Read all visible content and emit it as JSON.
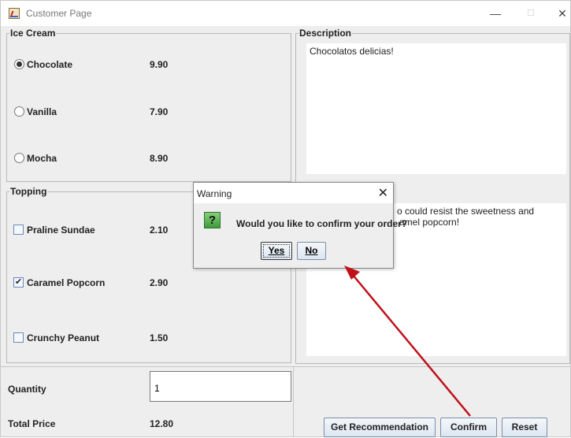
{
  "window": {
    "title": "Customer Page",
    "minimize_glyph": "—",
    "maximize_glyph": "☐",
    "close_glyph": "✕"
  },
  "ice_cream": {
    "title": "Ice Cream",
    "items": [
      {
        "label": "Chocolate",
        "price": "9.90",
        "selected": true
      },
      {
        "label": "Vanilla",
        "price": "7.90",
        "selected": false
      },
      {
        "label": "Mocha",
        "price": "8.90",
        "selected": false
      }
    ]
  },
  "topping": {
    "title": "Topping",
    "items": [
      {
        "label": "Praline Sundae",
        "price": "2.10",
        "checked": false
      },
      {
        "label": "Caramel Popcorn",
        "price": "2.90",
        "checked": true
      },
      {
        "label": "Crunchy Peanut",
        "price": "1.50",
        "checked": false
      }
    ]
  },
  "description": {
    "title": "Description",
    "ice_cream_text": "Chocolatos delicias!",
    "topping_text_line1": "o could resist the sweetness and",
    "topping_text_line2": "amel popcorn!"
  },
  "order": {
    "quantity_label": "Quantity",
    "quantity_value": "1",
    "total_label": "Total Price",
    "total_value": "12.80"
  },
  "buttons": {
    "recommend": "Get Recommendation",
    "confirm": "Confirm",
    "reset": "Reset"
  },
  "dialog": {
    "title": "Warning",
    "close_glyph": "✕",
    "icon_glyph": "?",
    "message": "Would you like to confirm your order?",
    "yes": "Yes",
    "no": "No"
  },
  "colors": {
    "annotation_arrow": "#c0101a"
  },
  "icons": {
    "app": "java-app-icon",
    "dialog": "question-icon"
  }
}
